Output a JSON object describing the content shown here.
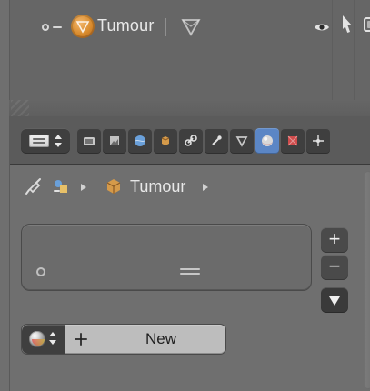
{
  "outliner": {
    "object_name": "Tumour"
  },
  "properties": {
    "context": {
      "object_name": "Tumour"
    },
    "new_material_label": "New"
  },
  "colors": {
    "accent": "#5b86c5",
    "object_orange": "#d98b2b"
  },
  "icons": {
    "outliner": [
      "tree-toggle-icon",
      "object-icon",
      "mesh-icon",
      "eye-icon",
      "cursor-icon",
      "render-icon"
    ],
    "properties_tabs": [
      "render-tab-icon",
      "scene-tab-icon",
      "world-tab-icon",
      "object-tab-icon",
      "constraints-tab-icon",
      "modifiers-tab-icon",
      "data-tab-icon",
      "material-tab-icon",
      "texture-tab-icon",
      "particles-tab-icon"
    ]
  }
}
